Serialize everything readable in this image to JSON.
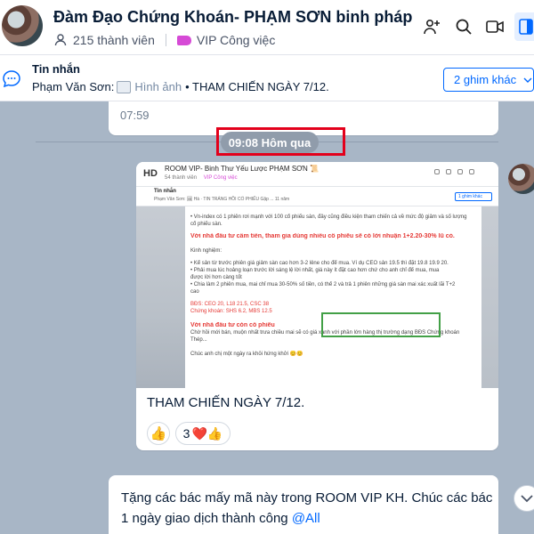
{
  "header": {
    "title": "Đàm Đạo Chứng Khoán- PHẠM SƠN binh pháp ",
    "members": "215 thành viên",
    "tag": "VIP Công việc"
  },
  "pinned": {
    "label": "Tin nhắn",
    "sender": "Phạm Văn Sơn:",
    "image_label": "Hình ảnh",
    "text": "• THAM CHIẾN NGÀY 7/12.",
    "more_button": "2 ghim khác"
  },
  "chat": {
    "prev_time": "07:59",
    "divider_time": "09:08 Hôm qua",
    "image_msg": {
      "caption": "THAM CHIẾN NGÀY 7/12.",
      "reactions": [
        {
          "emoji": "👍",
          "count": ""
        },
        {
          "emoji": "❤️👍",
          "count": "3"
        }
      ],
      "screenshot": {
        "avatar_text": "HD",
        "title": "ROOM VIP- Binh Thư Yếu Lược PHẠM SƠN 📜",
        "members": "54 thành viên",
        "tag": "VIP Công việc",
        "pin_label": "Tin nhắn",
        "pin_desc": "Phạm Văn Sơn: 🖼 Hà · TIN TRÁNG HỒI CỔ PHIẾU Gặp ... 11 năm",
        "pin_button": "1 ghim khác",
        "lines": [
          "• Vn-index có 1 phiên rơi mạnh với 100 cổ phiếu sàn, đây cũng điều kiện tham chiến cả về mức độ giảm và số lượng",
          "  cổ phiếu sàn.",
          "Với nhà đầu tư cầm tiền, tham gia dùng nhiều cổ phiếu sẽ có lời nhuận 1+2.20-30% lũ cỏ.",
          "Kinh nghiệm:",
          "• Kể sản từ trước phiên giá giảm sàn cao hơn 3-2 lẻne cho để mua. Ví dụ CEO sản 19.5 thì đặt 19.8 19.9 20.",
          "• Phải mua lúc hoảng loạn trước lời sáng lệ lời nhất, giá này ít đặt cao hơn chứ cho anh chỉ để mua, mua",
          "  được lời hơn càng tốt",
          "• Chia làm 2 phiên mua, mai chỉ mua 30-50% số tiền, có thể 2 và trả 1 phiên những giá sàn mai xác xuất lãi T+2",
          "  cao",
          "BĐS: CEO 20, L18 21.5, CSC 38",
          "Chứng khoán: SHS 6.2, MBS 12.5",
          "Với nhà đầu tư còn cổ phiếu",
          "Chờ hồi mới bán, muộn nhất trưa chiều mai sẽ có giá xanh với phần lớn hàng thị trường dạng BĐS Chứng khoán",
          "Thép...",
          "Chúc anh chị một ngày ra khỏi hứng khởi 😊😊"
        ]
      }
    },
    "next_msg": {
      "text": "Tặng các bác mấy mã này trong ROOM VIP KH. Chúc các bác 1 ngày giao dịch thành công ",
      "mention": "@All"
    }
  }
}
